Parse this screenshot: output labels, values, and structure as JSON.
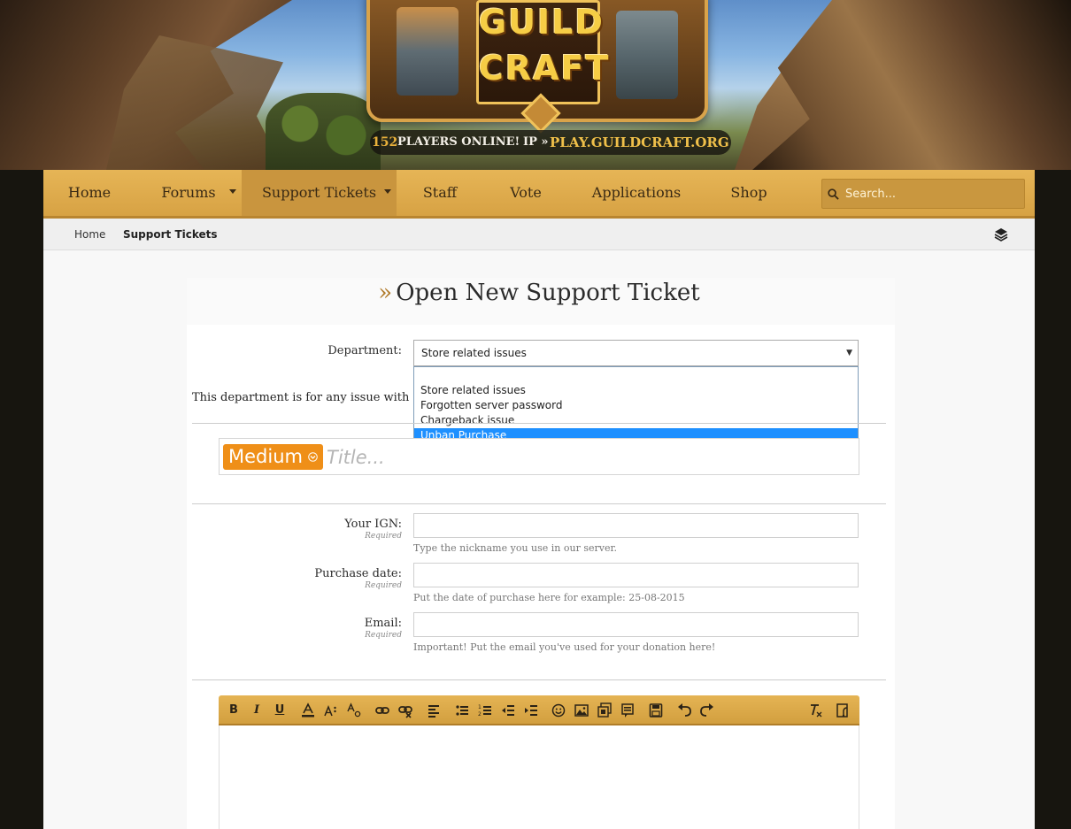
{
  "header": {
    "logo_lines": [
      "GUILD",
      "CRAFT"
    ],
    "players_count": "152",
    "players_label": "PLAYERS ONLINE!",
    "ip_label": "IP »",
    "server_address": "PLAY.GUILDCRAFT.ORG"
  },
  "nav": {
    "items": [
      {
        "label": "Home",
        "icon": null
      },
      {
        "label": "Forums",
        "icon": "caret-down-icon"
      },
      {
        "label": "Support Tickets",
        "icon": "caret-down-icon",
        "active": true
      },
      {
        "label": "Staff"
      },
      {
        "label": "Vote"
      },
      {
        "label": "Applications"
      },
      {
        "label": "Shop"
      }
    ],
    "search_placeholder": "Search..."
  },
  "breadcrumb": {
    "items": [
      "Home",
      "Support Tickets"
    ]
  },
  "page": {
    "title_prefix": "»",
    "title": "Open New Support Ticket"
  },
  "form": {
    "department": {
      "label": "Department:",
      "value": "Store related issues",
      "options": [
        "Store related issues",
        "Forgotten server password",
        "Chargeback issue",
        "Unban Purchase"
      ],
      "highlighted": "Unban Purchase"
    },
    "department_description": "This department is for any issue with our st",
    "priority": "Medium",
    "title_placeholder": "Title...",
    "fields": [
      {
        "label": "Your IGN:",
        "required": "Required",
        "value": "",
        "help": "Type the nickname you use in our server."
      },
      {
        "label": "Purchase date:",
        "required": "Required",
        "value": "",
        "help": "Put the date of purchase here for example: 25-08-2015"
      },
      {
        "label": "Email:",
        "required": "Required",
        "value": "",
        "help": "Important! Put the email you've used for your donation here!"
      }
    ]
  },
  "editor_toolbar": {
    "buttons": [
      "bold-icon",
      "italic-icon",
      "underline-icon",
      "font-color-icon",
      "superscript-icon",
      "subscript-icon",
      "link-icon",
      "unlink-icon",
      "align-left-icon",
      "bullet-list-icon",
      "numbered-list-icon",
      "outdent-icon",
      "indent-icon",
      "emoji-icon",
      "image-icon",
      "media-icon",
      "quote-icon",
      "save-icon",
      "undo-icon",
      "redo-icon",
      "clear-format-icon",
      "source-icon"
    ],
    "labels": {
      "bold": "B",
      "italic": "I",
      "underline": "U"
    }
  },
  "colors": {
    "nav_gold": "#d7a244",
    "accent_orange": "#ef8f18",
    "selection_blue": "#1e90ff",
    "player_count_gold": "#e9b13b"
  }
}
